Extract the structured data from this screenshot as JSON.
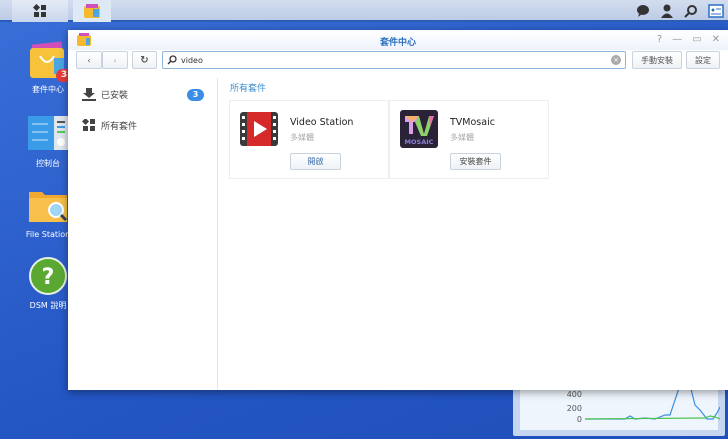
{
  "taskbar": {
    "icons": [
      "main-menu-icon",
      "package-center-icon"
    ],
    "right_icons": [
      "chat-icon",
      "user-icon",
      "search-icon",
      "widgets-icon"
    ]
  },
  "desktop": {
    "items": [
      {
        "label": "套件中心",
        "badge": "3"
      },
      {
        "label": "控制台"
      },
      {
        "label": "File Station"
      },
      {
        "label": "DSM 說明"
      }
    ]
  },
  "window": {
    "title": "套件中心",
    "search_value": "video",
    "manual_install": "手動安裝",
    "settings": "設定"
  },
  "sidebar": {
    "items": [
      {
        "label": "已安裝",
        "badge": "3"
      },
      {
        "label": "所有套件"
      }
    ]
  },
  "main": {
    "section_title": "所有套件",
    "packages": [
      {
        "name": "Video Station",
        "category": "多媒體",
        "action": "開啟"
      },
      {
        "name": "TVMosaic",
        "category": "多媒體",
        "action": "安裝套件",
        "logo_text": "MOSAIC"
      }
    ]
  },
  "widget": {
    "y_labels": [
      "400",
      "200",
      "0"
    ]
  },
  "colors": {
    "accent": "#3a8ed0",
    "desktop": "#2b5fc8"
  }
}
